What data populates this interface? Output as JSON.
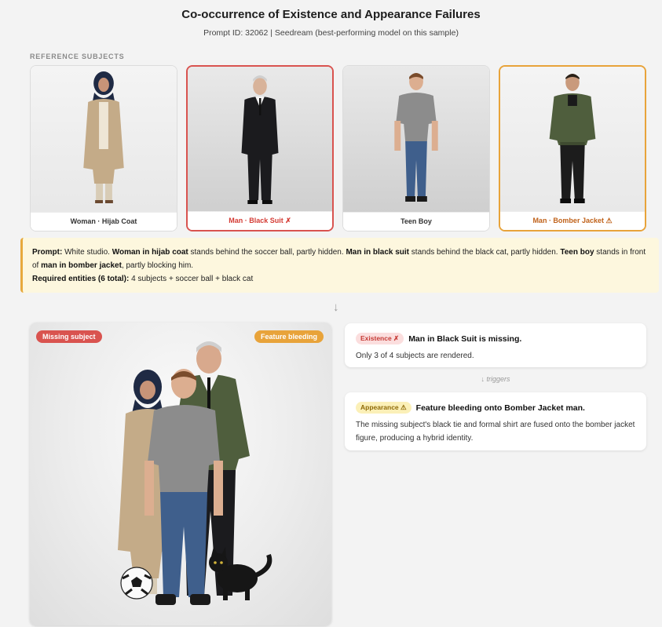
{
  "header": {
    "title": "Co-occurrence of Existence and Appearance Failures",
    "subtitle": "Prompt ID: 32062  |  Seedream (best-performing model on this sample)"
  },
  "reference": {
    "section_label": "REFERENCE SUBJECTS",
    "subjects": [
      {
        "caption": "Woman · Hijab Coat",
        "status": "ok"
      },
      {
        "caption": "Man · Black Suit ✗",
        "status": "missing"
      },
      {
        "caption": "Teen Boy",
        "status": "ok"
      },
      {
        "caption": "Man · Bomber Jacket ⚠",
        "status": "bleeding"
      }
    ]
  },
  "prompt": {
    "label": "Prompt:",
    "t1": " White studio. ",
    "b1": "Woman in hijab coat",
    "t2": " stands behind the soccer ball, partly hidden. ",
    "b2": "Man in black suit",
    "t3": " stands behind the black cat, partly hidden. ",
    "b3": "Teen boy",
    "t4": " stands in front of ",
    "b4": "man in bomber jacket",
    "t5": ", partly blocking him.",
    "required_label": "Required entities (6 total):",
    "required_text": " 4 subjects + soccer ball + black cat"
  },
  "flow": {
    "down_arrow": "↓",
    "triggers": "↓ triggers"
  },
  "generated": {
    "tag_missing": "Missing subject",
    "tag_bleeding": "Feature bleeding"
  },
  "existence": {
    "badge": "Existence ✗",
    "heading": "Man in Black Suit is missing.",
    "body": "Only 3 of 4 subjects are rendered."
  },
  "appearance": {
    "badge": "Appearance ⚠",
    "heading": "Feature bleeding onto Bomber Jacket man.",
    "body": "The missing subject's black tie and formal shirt are fused onto the bomber jacket figure, producing a hybrid identity."
  },
  "colors": {
    "accent_red": "#d9534f",
    "accent_orange": "#e8a33a",
    "prompt_bg": "#fdf7de"
  }
}
